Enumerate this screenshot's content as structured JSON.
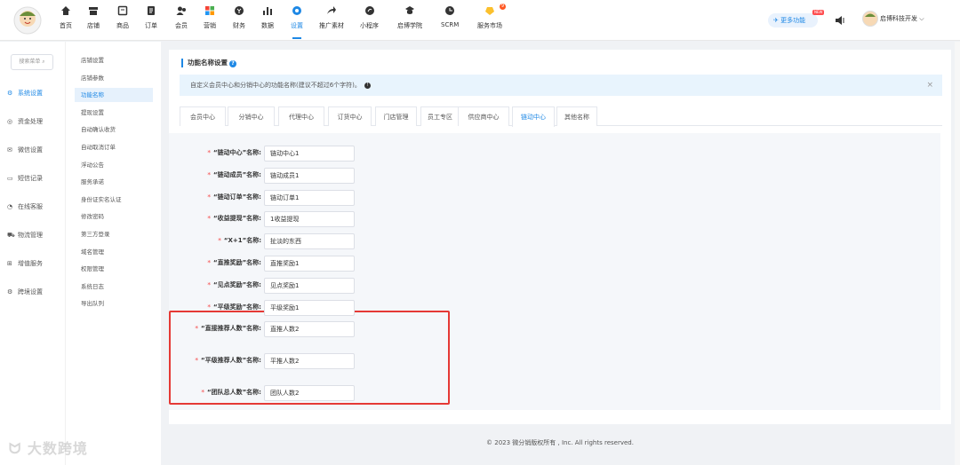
{
  "nav": [
    {
      "label": "首页",
      "icon": "home-icon"
    },
    {
      "label": "店铺",
      "icon": "store-icon"
    },
    {
      "label": "商品",
      "icon": "goods-icon"
    },
    {
      "label": "订单",
      "icon": "order-icon"
    },
    {
      "label": "会员",
      "icon": "member-icon"
    },
    {
      "label": "营销",
      "icon": "marketing-icon"
    },
    {
      "label": "财务",
      "icon": "finance-icon"
    },
    {
      "label": "数据",
      "icon": "data-icon"
    },
    {
      "label": "设置",
      "icon": "settings-icon",
      "active": true
    },
    {
      "label": "推广素材",
      "icon": "share-icon"
    },
    {
      "label": "小程序",
      "icon": "miniapp-icon"
    },
    {
      "label": "启博学院",
      "icon": "academy-icon"
    },
    {
      "label": "SCRM",
      "icon": "scrm-icon"
    },
    {
      "label": "服务市场",
      "icon": "market-icon"
    }
  ],
  "header": {
    "more_label": "更多功能",
    "new_badge": "NEW",
    "user_name": "启博科技开发",
    "market_badge": "9"
  },
  "sidebar": {
    "search_placeholder": "搜索菜单",
    "items": [
      {
        "label": "系统设置",
        "active": true
      },
      {
        "label": "资金处理"
      },
      {
        "label": "微信设置"
      },
      {
        "label": "短信记录"
      },
      {
        "label": "在线客服"
      },
      {
        "label": "物流管理"
      },
      {
        "label": "增值服务"
      },
      {
        "label": "跨境设置"
      }
    ]
  },
  "subsidebar": {
    "items": [
      "店铺设置",
      "店铺参数",
      "功能名称",
      "提现设置",
      "自动确认收货",
      "自动取消订单",
      "浮动公告",
      "服务承诺",
      "身份证实名认证",
      "修改密码",
      "第三方登录",
      "域名管理",
      "权限管理",
      "系统日志",
      "导出队列"
    ],
    "active_index": 2
  },
  "main": {
    "title": "功能名称设置",
    "alert": "自定义会员中心和分销中心的功能名称(建议不超过6个字符)。",
    "alert_close": "×",
    "tabs": [
      "会员中心",
      "分销中心",
      "代理中心",
      "订货中心",
      "门店管理",
      "员工专区",
      "供应商中心",
      "链动中心",
      "其他名称"
    ],
    "active_tab": 7,
    "fields": [
      {
        "label": "“链动中心”名称:",
        "value": "链动中心1"
      },
      {
        "label": "“链动成员”名称:",
        "value": "链动成员1"
      },
      {
        "label": "“链动订单”名称:",
        "value": "链动订单1"
      },
      {
        "label": "“收益提现”名称:",
        "value": "1收益提现"
      },
      {
        "label": "“X+1”名称:",
        "value": "扯淡的东西"
      },
      {
        "label": "“直推奖励”名称:",
        "value": "直推奖励1"
      },
      {
        "label": "“见点奖励”名称:",
        "value": "见点奖励1"
      },
      {
        "label": "“平级奖励”名称:",
        "value": "平级奖励1"
      },
      {
        "label": "“直接推荐人数”名称:",
        "value": "直推人数2"
      },
      {
        "label": "“平级推荐人数”名称:",
        "value": "平推人数2"
      },
      {
        "label": "“团队总人数”名称:",
        "value": "团队人数2"
      }
    ]
  },
  "footer": "© 2023 微分销版权所有 , Inc. All rights reserved.",
  "watermark": "大数跨境",
  "colors": {
    "accent": "#1e88e5",
    "required": "#f56c6c",
    "highlight": "#e53935"
  }
}
